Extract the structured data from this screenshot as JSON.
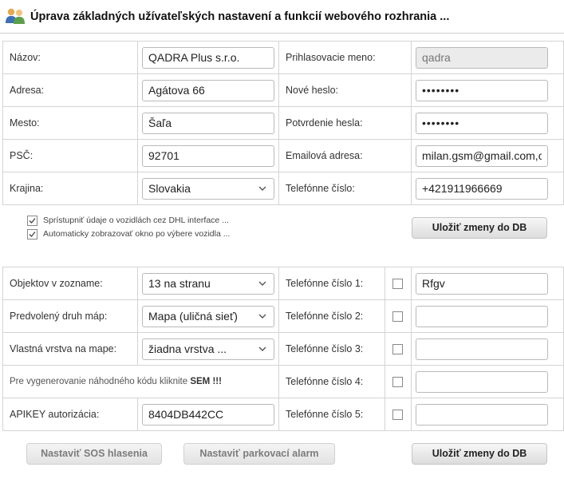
{
  "page": {
    "title": "Úprava základných užívateľských nastavení a funkcií webového rozhrania ..."
  },
  "company": {
    "name_label": "Názov:",
    "name_value": "QADRA Plus s.r.o.",
    "address_label": "Adresa:",
    "address_value": "Agátova 66",
    "city_label": "Mesto:",
    "city_value": "Šaľa",
    "zip_label": "PSČ:",
    "zip_value": "92701",
    "country_label": "Krajina:",
    "country_value": "Slovakia"
  },
  "account": {
    "login_label": "Prihlasovacie meno:",
    "login_value": "qadra",
    "new_password_label": "Nové heslo:",
    "new_password_value": "••••••••",
    "confirm_password_label": "Potvrdenie hesla:",
    "confirm_password_value": "••••••••",
    "email_label": "Emailová adresa:",
    "email_value": "milan.gsm@gmail.com,or",
    "phone_label": "Telefónne číslo:",
    "phone_value": "+421911966669"
  },
  "options": {
    "share_dhl": {
      "label": "Sprístupniť údaje o vozidlách cez DHL interface ...",
      "checked": true
    },
    "auto_window": {
      "label": "Automaticky zobrazovať okno po výbere vozidla ...",
      "checked": true
    }
  },
  "save_button_label": "Uložiť zmeny do DB",
  "settings": {
    "objects_label": "Objektov v zozname:",
    "objects_value": "13 na stranu",
    "map_type_label": "Predvolený druh máp:",
    "map_type_value": "Mapa (uličná sieť)",
    "layer_label": "Vlastná vrstva na mape:",
    "layer_value": "žiadna vrstva ...",
    "random_code_hint": "Pre vygenerovanie náhodného kódu kliknite",
    "random_code_link": "SEM !!!",
    "apikey_label": "APIKEY autorizácia:",
    "apikey_value": "8404DB442CC"
  },
  "phones": [
    {
      "label": "Telefónne číslo 1:",
      "value": "Rfgv",
      "checked": false
    },
    {
      "label": "Telefónne číslo 2:",
      "value": "",
      "checked": false
    },
    {
      "label": "Telefónne číslo 3:",
      "value": "",
      "checked": false
    },
    {
      "label": "Telefónne číslo 4:",
      "value": "",
      "checked": false
    },
    {
      "label": "Telefónne číslo 5:",
      "value": "",
      "checked": false
    }
  ],
  "buttons": {
    "sos": "Nastaviť SOS hlasenia",
    "parking": "Nastaviť parkovací alarm",
    "save_bottom": "Uložiť zmeny do DB"
  },
  "icons": {
    "header_icon": "users-icon",
    "select_arrow": "chevron-down-icon",
    "check_mark": "check-icon"
  }
}
